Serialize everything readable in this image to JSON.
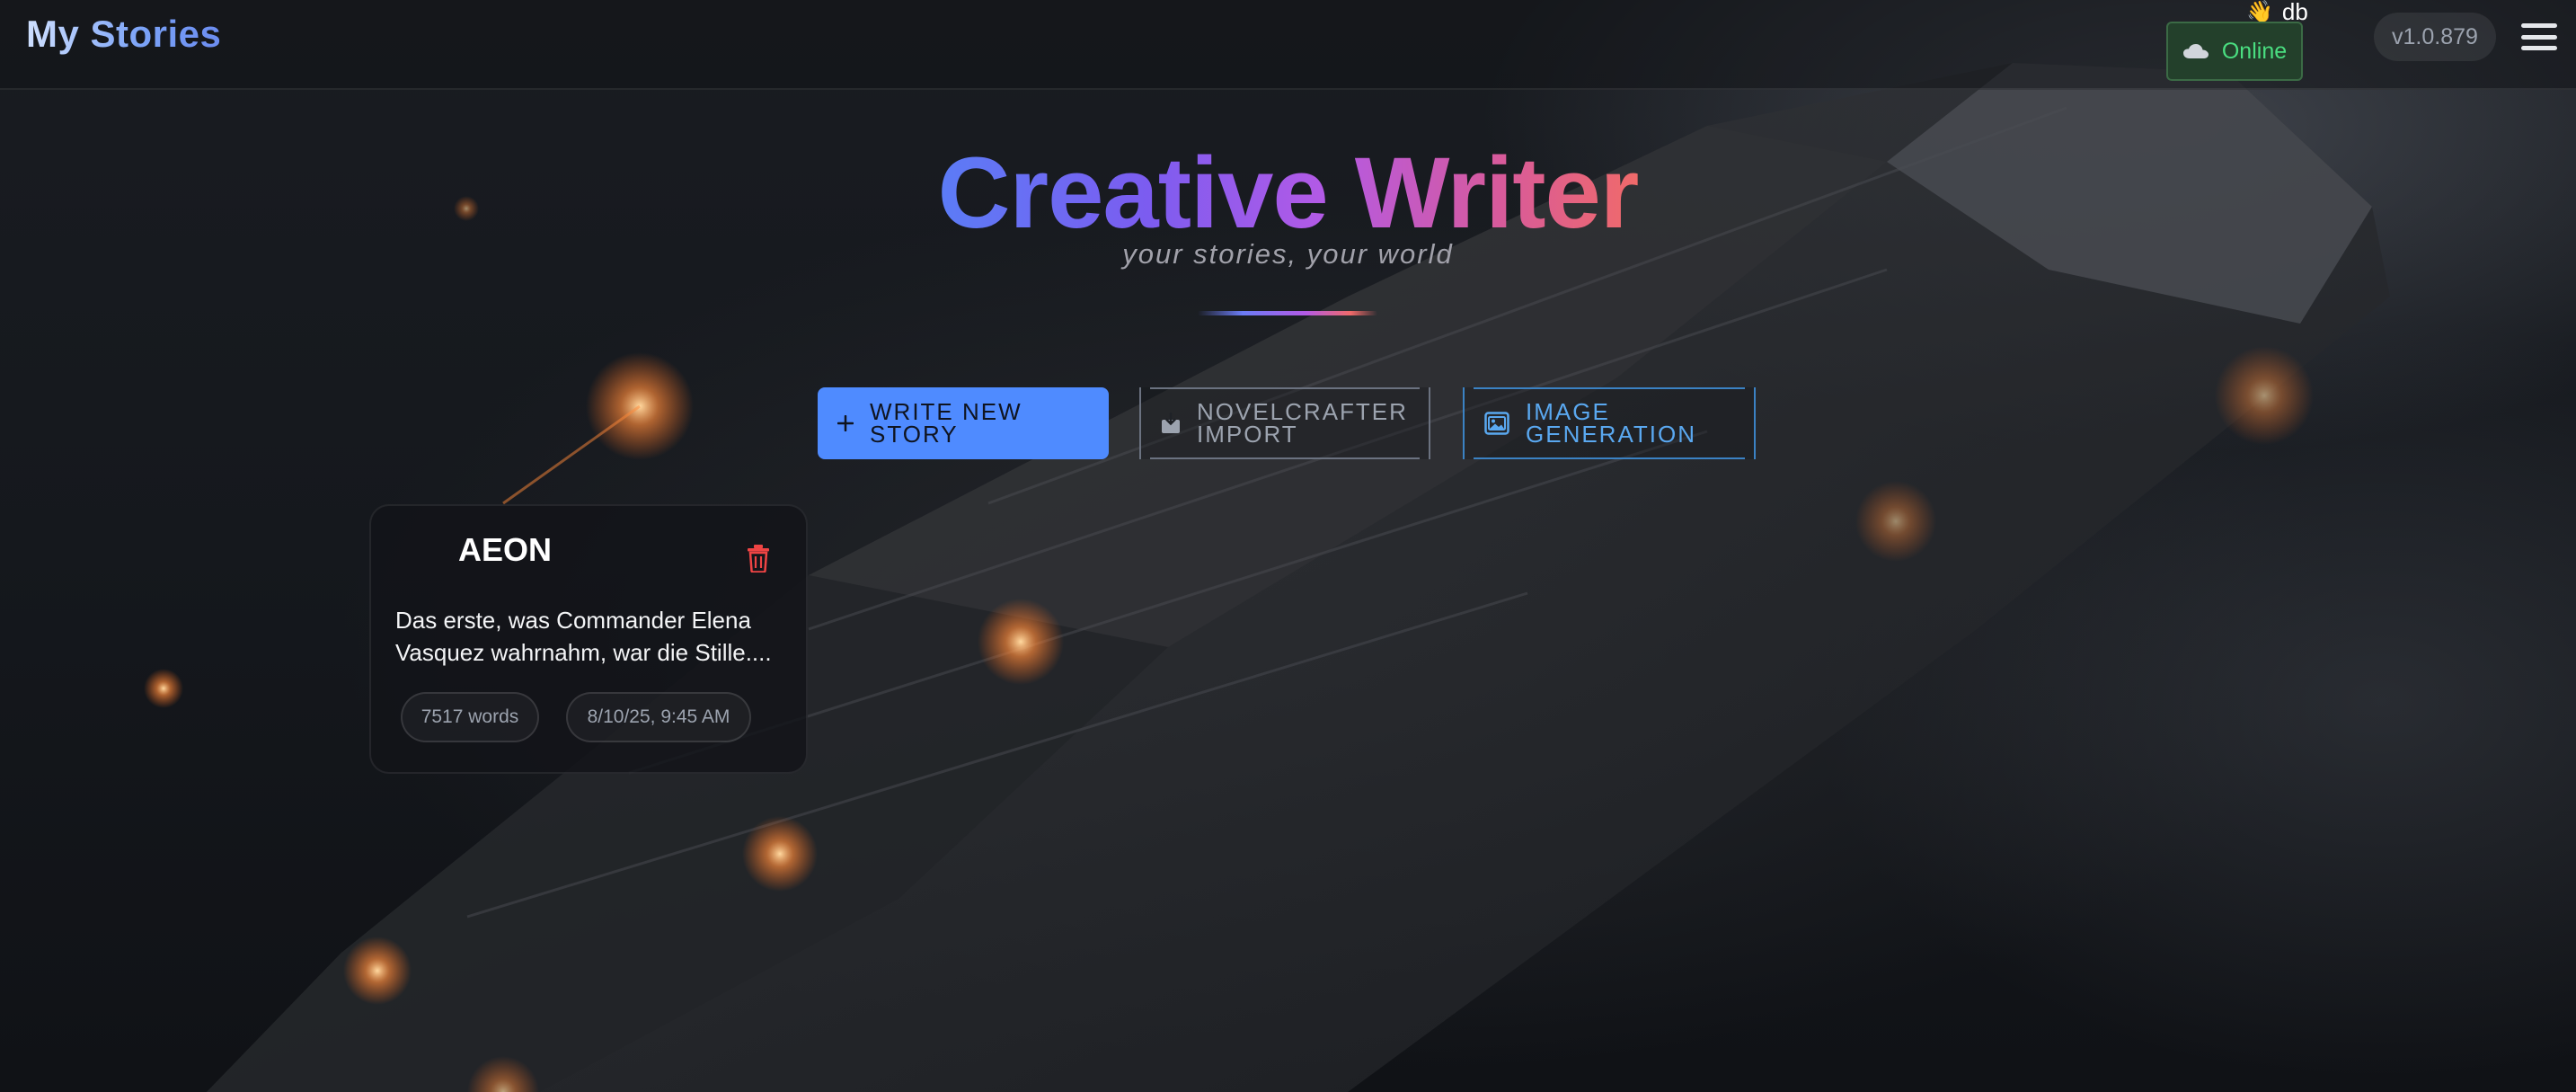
{
  "header": {
    "title": "My Stories",
    "user": {
      "wave_icon": "waving-hand-icon",
      "name": "db"
    },
    "status": {
      "icon": "cloud-icon",
      "label": "Online",
      "color": "#4ade80"
    },
    "version": "v1.0.879",
    "menu_icon": "hamburger-menu-icon"
  },
  "hero": {
    "title": "Creative Writer",
    "subtitle": "your stories, your world"
  },
  "actions": {
    "new_story": {
      "label": "Write new\nstory",
      "icon": "plus-icon",
      "color": "#4f8bff"
    },
    "import": {
      "label": "NovelCrafter\nimport",
      "icon": "import-icon"
    },
    "image_generation": {
      "label": "Image\ngeneration",
      "icon": "image-icon",
      "color": "#5aa8f0"
    }
  },
  "stories": [
    {
      "title": "AEON",
      "excerpt": "Das erste, was Commander Elena Vasquez wahrnahm, war die Stille....",
      "words": "7517 words",
      "date": "8/10/25, 9:45 AM",
      "delete_icon": "trash-icon",
      "delete_color": "#ef4444"
    }
  ]
}
